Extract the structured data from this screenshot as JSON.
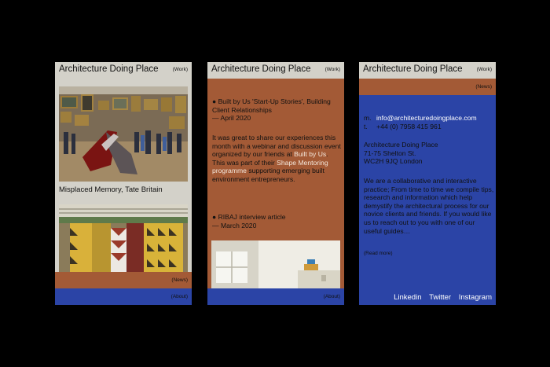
{
  "site_title": "Architecture Doing Place",
  "nav": {
    "work": "(Work)",
    "news": "(News)",
    "about": "(About)"
  },
  "screen1": {
    "caption": "Misplaced Memory, Tate Britain"
  },
  "screen2": {
    "post1_title": "● Built by Us 'Start-Up Stories', Building Client Relationships",
    "post1_date": "— April 2020",
    "body_a": "It was great to share our experiences this month with a webinar and discussion event organized by our friends at ",
    "link_built_by_us": "Built by Us",
    "body_b": ". This was part of their ",
    "link_programme": "Shape Mentoring programme",
    "body_c": " supporting emerging built environment entrepreneurs.",
    "post2_title": "● RIBAJ interview article",
    "post2_date": "— March 2020"
  },
  "screen3": {
    "email_label": "m.",
    "email": "info@architecturedoingplace.com",
    "phone_label": "t.",
    "phone": "+44 (0) 7958 415 961",
    "address_name": "Architecture Doing Place",
    "address_street": "71-75 Shelton St.",
    "address_city": "WC2H 9JQ London",
    "about": "We are a collaborative and interactive practice; From time to time we compile tips, research and information which help demystify the architectural process for our novice clients and friends. If you would like us to reach out to you with one of our useful guides…",
    "read_more": "(Read more)",
    "social": [
      "Linkedin",
      "Twitter",
      "Instagram"
    ]
  },
  "colors": {
    "grey": "#d3d1c9",
    "brown": "#a35a36",
    "blue": "#2b44a6",
    "background": "#000000"
  }
}
